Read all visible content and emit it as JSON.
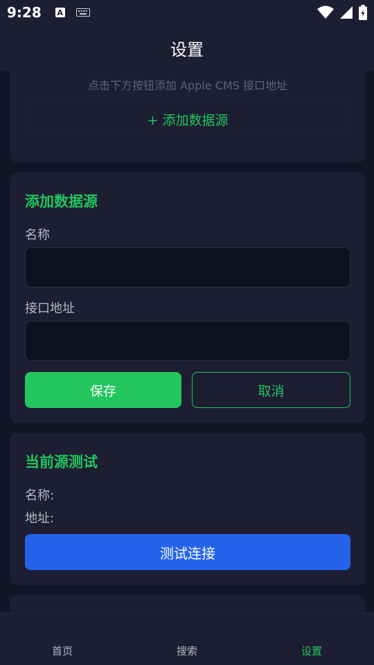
{
  "status_bar": {
    "time": "9:28",
    "notification_icon_letter": "A",
    "icons": [
      "keyboard-icon",
      "wifi-icon",
      "signal-icon",
      "battery-icon"
    ]
  },
  "header": {
    "title": "设置"
  },
  "source_card": {
    "hint": "点击下方按钮添加 Apple CMS 接口地址",
    "add_label": "+ 添加数据源"
  },
  "form": {
    "heading": "添加数据源",
    "name_label": "名称",
    "name_value": "",
    "url_label": "接口地址",
    "url_value": "",
    "save_label": "保存",
    "cancel_label": "取消"
  },
  "test": {
    "heading": "当前源测试",
    "name_line": "名称:",
    "url_line": "地址:",
    "test_label": "测试连接"
  },
  "nav": {
    "items": [
      {
        "label": "首页"
      },
      {
        "label": "搜索"
      },
      {
        "label": "设置"
      }
    ],
    "active_index": 2
  },
  "colors": {
    "accent_green": "#22c55e",
    "accent_blue": "#2563eb",
    "background": "#131426",
    "card": "#1d1e32"
  }
}
